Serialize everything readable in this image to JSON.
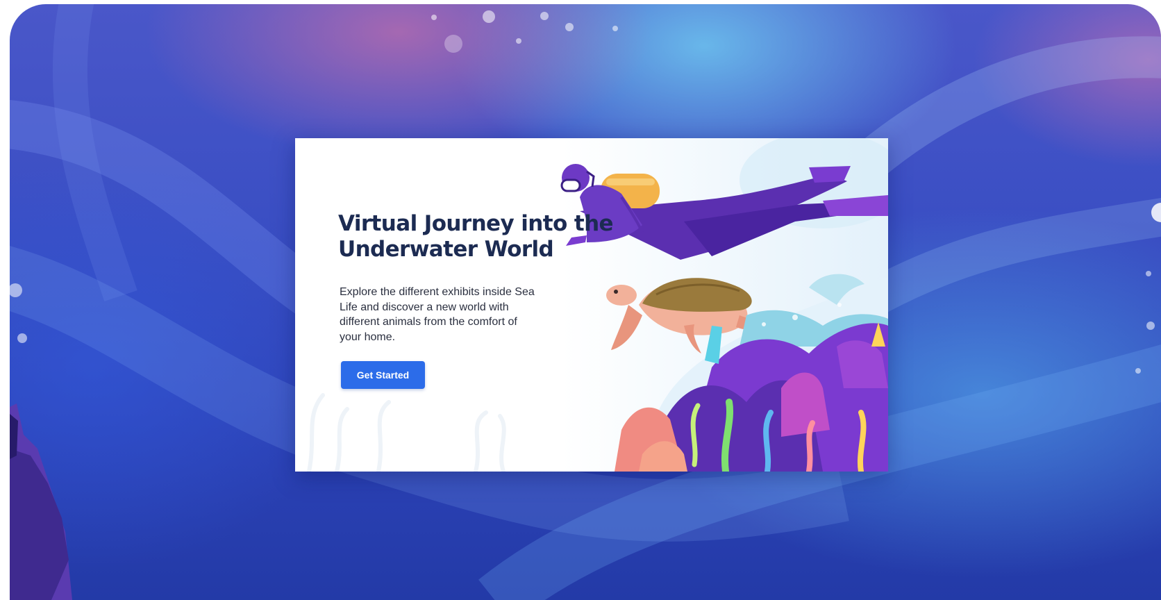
{
  "hero": {
    "headline": "Virtual Journey into the Underwater World",
    "description": "Explore the different exhibits inside Sea Life and discover a new world with different animals from the comfort of your home.",
    "cta_label": "Get Started"
  },
  "illustrations": {
    "diver": "scuba-diver-illustration",
    "turtle": "sea-turtle-illustration",
    "reef": "coral-reef-illustration",
    "bubbles": "bubbles-decoration"
  },
  "colors": {
    "accent": "#2c6ce9",
    "headline": "#1c2b52",
    "background_deep": "#233aa7",
    "background_light": "#6ec8f0"
  }
}
